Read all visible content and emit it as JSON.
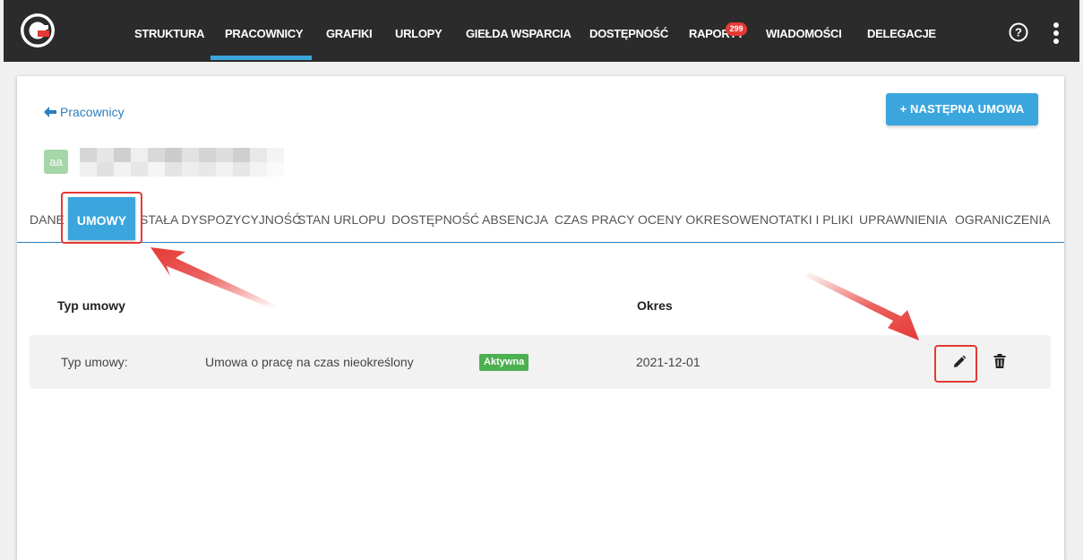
{
  "nav": {
    "items": [
      "STRUKTURA",
      "PRACOWNICY",
      "GRAFIKI",
      "URLOPY",
      "GIEŁDA WSPARCIA",
      "DOSTĘPNOŚĆ",
      "RAPORTY",
      "WIADOMOŚCI",
      "DELEGACJE"
    ],
    "active_item": "PRACOWNICY",
    "reports_badge": "299"
  },
  "header": {
    "back_label": "Pracownicy",
    "next_contract_label": "+ NASTĘPNA UMOWA"
  },
  "employee": {
    "avatar_initials": "aa"
  },
  "tabs": {
    "items": [
      "DANE",
      "UMOWY",
      "STAŁA DYSPOZYCYJNOŚĆ",
      "STAN URLOPU",
      "DOSTĘPNOŚĆ",
      "ABSENCJA",
      "CZAS PRACY",
      "OCENY OKRESOWE",
      "NOTATKI I PLIKI",
      "UPRAWNIENIA",
      "OGRANICZENIA"
    ],
    "active": "UMOWY"
  },
  "table": {
    "headers": [
      "Typ umowy",
      "Okres"
    ],
    "rows": [
      {
        "label": "Typ umowy:",
        "type": "Umowa o pracę na czas nieokreślony",
        "status": "Aktywna",
        "period": "2021-12-01"
      }
    ]
  },
  "colors": {
    "topbar": "#2b2b2b",
    "accent": "#3ba6dd",
    "status_active": "#4caf50",
    "annotation": "#e53935"
  }
}
